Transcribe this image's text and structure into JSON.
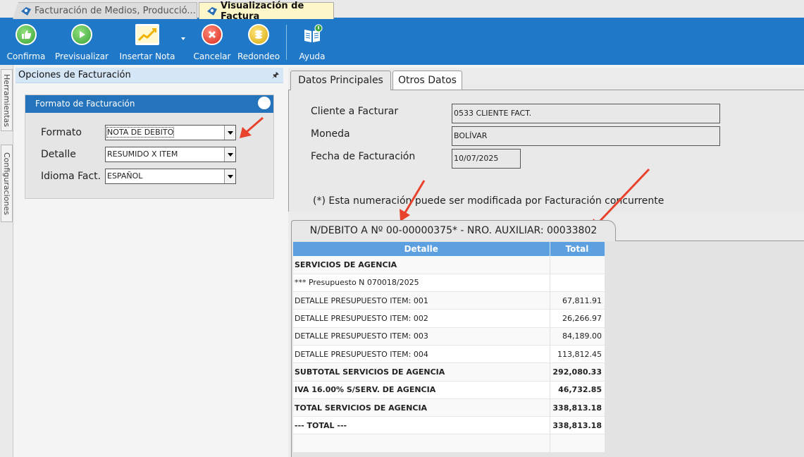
{
  "doc_tabs": [
    {
      "label": "Facturación de Medios, Producció..."
    },
    {
      "label": "Visualización de Factura"
    }
  ],
  "toolbar": {
    "confirma": "Confirma",
    "previsualizar": "Previsualizar",
    "insertar_nota": "Insertar Nota",
    "cancelar": "Cancelar",
    "redondeo": "Redondeo",
    "ayuda": "Ayuda"
  },
  "side_tabs": {
    "herramientas": "Herramientas",
    "configuraciones": "Configuraciones"
  },
  "options_panel": {
    "title": "Opciones de Facturación",
    "format_box_title": "Formato de Facturación",
    "formato_label": "Formato",
    "formato_value": "NOTA DE DEBITO",
    "detalle_label": "Detalle",
    "detalle_value": "RESUMIDO X ITEM",
    "idioma_label": "Idioma Fact.",
    "idioma_value": "ESPAÑOL"
  },
  "main": {
    "tabs": [
      {
        "label": "Datos Principales"
      },
      {
        "label": "Otros Datos"
      }
    ],
    "cliente_label": "Cliente a Facturar",
    "cliente_value": "0533 CLIENTE FACT.",
    "moneda_label": "Moneda",
    "moneda_value": "BOLÍVAR",
    "fecha_label": "Fecha de Facturación",
    "fecha_value": "10/07/2025",
    "note": "(*) Esta numeración puede ser modificada por Facturación concurrente"
  },
  "invoice": {
    "tab_label": "N/DEBITO A Nº 00-00000375* - NRO. AUXILIAR: 00033802",
    "col_detalle": "Detalle",
    "col_total": "Total",
    "rows": [
      {
        "detalle": "SERVICIOS DE AGENCIA",
        "total": ""
      },
      {
        "detalle": "*** Presupuesto N 070018/2025",
        "total": ""
      },
      {
        "detalle": "DETALLE PRESUPUESTO ITEM: 001",
        "total": "67,811.91"
      },
      {
        "detalle": "DETALLE PRESUPUESTO ITEM: 002",
        "total": "26,266.97"
      },
      {
        "detalle": "DETALLE PRESUPUESTO ITEM: 003",
        "total": "84,189.00"
      },
      {
        "detalle": "DETALLE PRESUPUESTO ITEM: 004",
        "total": "113,812.45"
      },
      {
        "detalle": "SUBTOTAL SERVICIOS DE AGENCIA",
        "total": "292,080.33"
      },
      {
        "detalle": "IVA 16.00% S/SERV. DE AGENCIA",
        "total": "46,732.85"
      },
      {
        "detalle": "TOTAL SERVICIOS DE AGENCIA",
        "total": "338,813.18"
      },
      {
        "detalle": "--- TOTAL ---",
        "total": "338,813.18"
      },
      {
        "detalle": "",
        "total": ""
      }
    ]
  },
  "colors": {
    "toolbar": "#1f78c8",
    "grid_header": "#5ca0df",
    "arrow": "#e8412c"
  }
}
